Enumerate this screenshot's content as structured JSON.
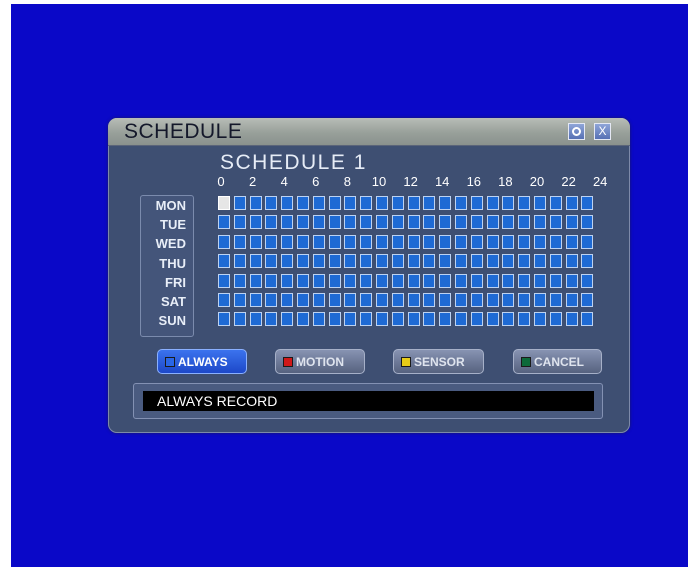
{
  "window": {
    "title": "SCHEDULE",
    "help_label": "",
    "close_label": "X"
  },
  "schedule": {
    "title": "SCHEDULE 1",
    "hour_labels": [
      "0",
      "2",
      "4",
      "6",
      "8",
      "10",
      "12",
      "14",
      "16",
      "18",
      "20",
      "22",
      "24"
    ],
    "days": [
      "MON",
      "TUE",
      "WED",
      "THU",
      "FRI",
      "SAT",
      "SUN"
    ],
    "slots_per_day": 24,
    "selected_cell": {
      "day": "MON",
      "hour": 0
    },
    "cell_color": "#1e6ad4",
    "selected_color": "#e6e6e6"
  },
  "buttons": [
    {
      "id": "always",
      "label": "ALWAYS",
      "swatch": "#2a66e6",
      "active": true
    },
    {
      "id": "motion",
      "label": "MOTION",
      "swatch": "#d01818",
      "active": false
    },
    {
      "id": "sensor",
      "label": "SENSOR",
      "swatch": "#e8cc18",
      "active": false
    },
    {
      "id": "cancel",
      "label": "CANCEL",
      "swatch": "#0c6a3a",
      "active": false
    }
  ],
  "status": {
    "text": "ALWAYS RECORD"
  },
  "colors": {
    "screen_background": "#0a08c8",
    "window_body": "#3e4f72"
  }
}
